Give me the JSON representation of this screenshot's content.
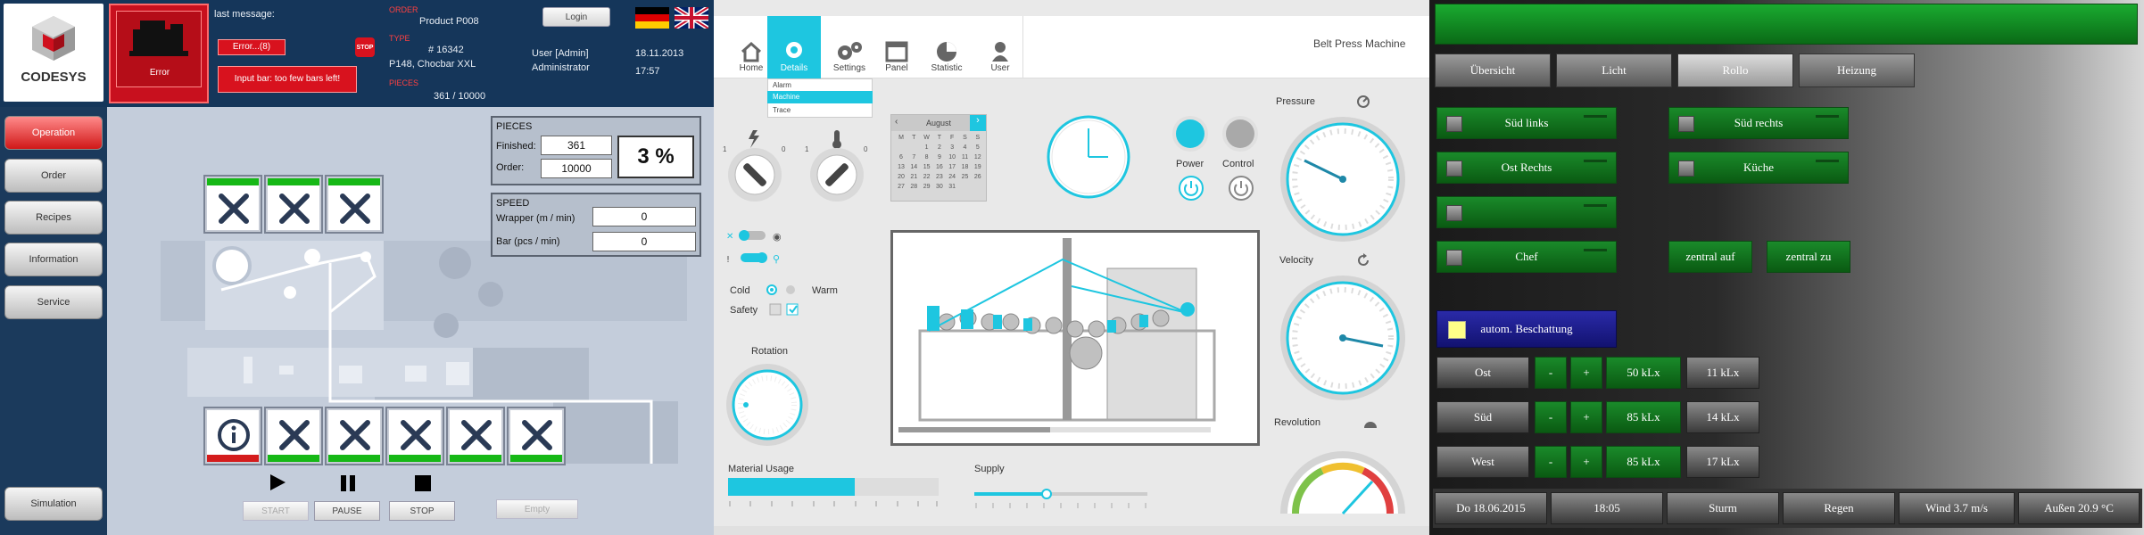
{
  "panel_a": {
    "logo_text": "CODESYS",
    "error_label": "Error",
    "last_message_label": "last message:",
    "error_btn": "Error...(8)",
    "error_msg": "Input bar: too few bars left!",
    "product_label": "ORDER",
    "product_value": "Product P008",
    "type_label": "TYPE",
    "type_num": "# 16342",
    "type_desc": "P148, Chocbar XXL",
    "pieces_label": "PIECES",
    "pieces_value": "361 / 10000",
    "login_btn": "Login",
    "user_line": "User [Admin]",
    "user_role": "Administrator",
    "date": "18.11.2013",
    "time": "17:57",
    "sidebar": [
      "Operation",
      "Order",
      "Recipes",
      "Information",
      "Service"
    ],
    "simulation": "Simulation",
    "pieces_box": {
      "title": "PIECES",
      "finished_label": "Finished:",
      "finished": "361",
      "order_label": "Order:",
      "order": "10000",
      "percent": "3 %"
    },
    "speed_box": {
      "title": "SPEED",
      "wrapper_label": "Wrapper (m / min)",
      "wrapper": "0",
      "bar_label": "Bar (pcs / min)",
      "bar": "0"
    },
    "controls": {
      "start": "START",
      "pause": "PAUSE",
      "stop": "STOP",
      "empty": "Empty"
    }
  },
  "panel_b": {
    "nav": [
      "Home",
      "Details",
      "Settings",
      "Panel",
      "Statistic",
      "User"
    ],
    "title": "Belt Press Machine",
    "dropdown": [
      "Alarm",
      "Machine",
      "Trace"
    ],
    "calendar": {
      "month": "August",
      "days": [
        "M",
        "T",
        "W",
        "T",
        "F",
        "S",
        "S"
      ],
      "weeks": [
        [
          "",
          "",
          "1",
          "2",
          "3",
          "4",
          "5"
        ],
        [
          "6",
          "7",
          "8",
          "9",
          "10",
          "11",
          "12"
        ],
        [
          "13",
          "14",
          "15",
          "16",
          "17",
          "18",
          "19"
        ],
        [
          "20",
          "21",
          "22",
          "23",
          "24",
          "25",
          "26"
        ],
        [
          "27",
          "28",
          "29",
          "30",
          "31",
          "",
          ""
        ]
      ]
    },
    "power_label": "Power",
    "control_label": "Control",
    "pressure_label": "Pressure",
    "velocity_label": "Velocity",
    "revolution_label": "Revolution",
    "cold_label": "Cold",
    "warm_label": "Warm",
    "safety_label": "Safety",
    "rotation_label": "Rotation",
    "material_label": "Material Usage",
    "material_level": 0.6,
    "supply_label": "Supply",
    "supply_level": 0.42
  },
  "panel_c": {
    "tabs": [
      "Übersicht",
      "Licht",
      "Rollo",
      "Heizung"
    ],
    "active_tab": "Rollo",
    "rollos": [
      "Süd links",
      "Süd rechts",
      "Ost Rechts",
      "Küche",
      "",
      "Chef"
    ],
    "zentral_auf": "zentral auf",
    "zentral_zu": "zentral zu",
    "autom": "autom. Beschattung",
    "rows": [
      {
        "name": "Ost",
        "minus": "-",
        "plus": "+",
        "set": "50 kLx",
        "cur": "11 kLx"
      },
      {
        "name": "Süd",
        "minus": "-",
        "plus": "+",
        "set": "85 kLx",
        "cur": "14 kLx"
      },
      {
        "name": "West",
        "minus": "-",
        "plus": "+",
        "set": "85 kLx",
        "cur": "17 kLx"
      }
    ],
    "status": [
      "Do 18.06.2015",
      "18:05",
      "Sturm",
      "Regen",
      "Wind 3.7 m/s",
      "Außen 20.9 °C"
    ]
  }
}
